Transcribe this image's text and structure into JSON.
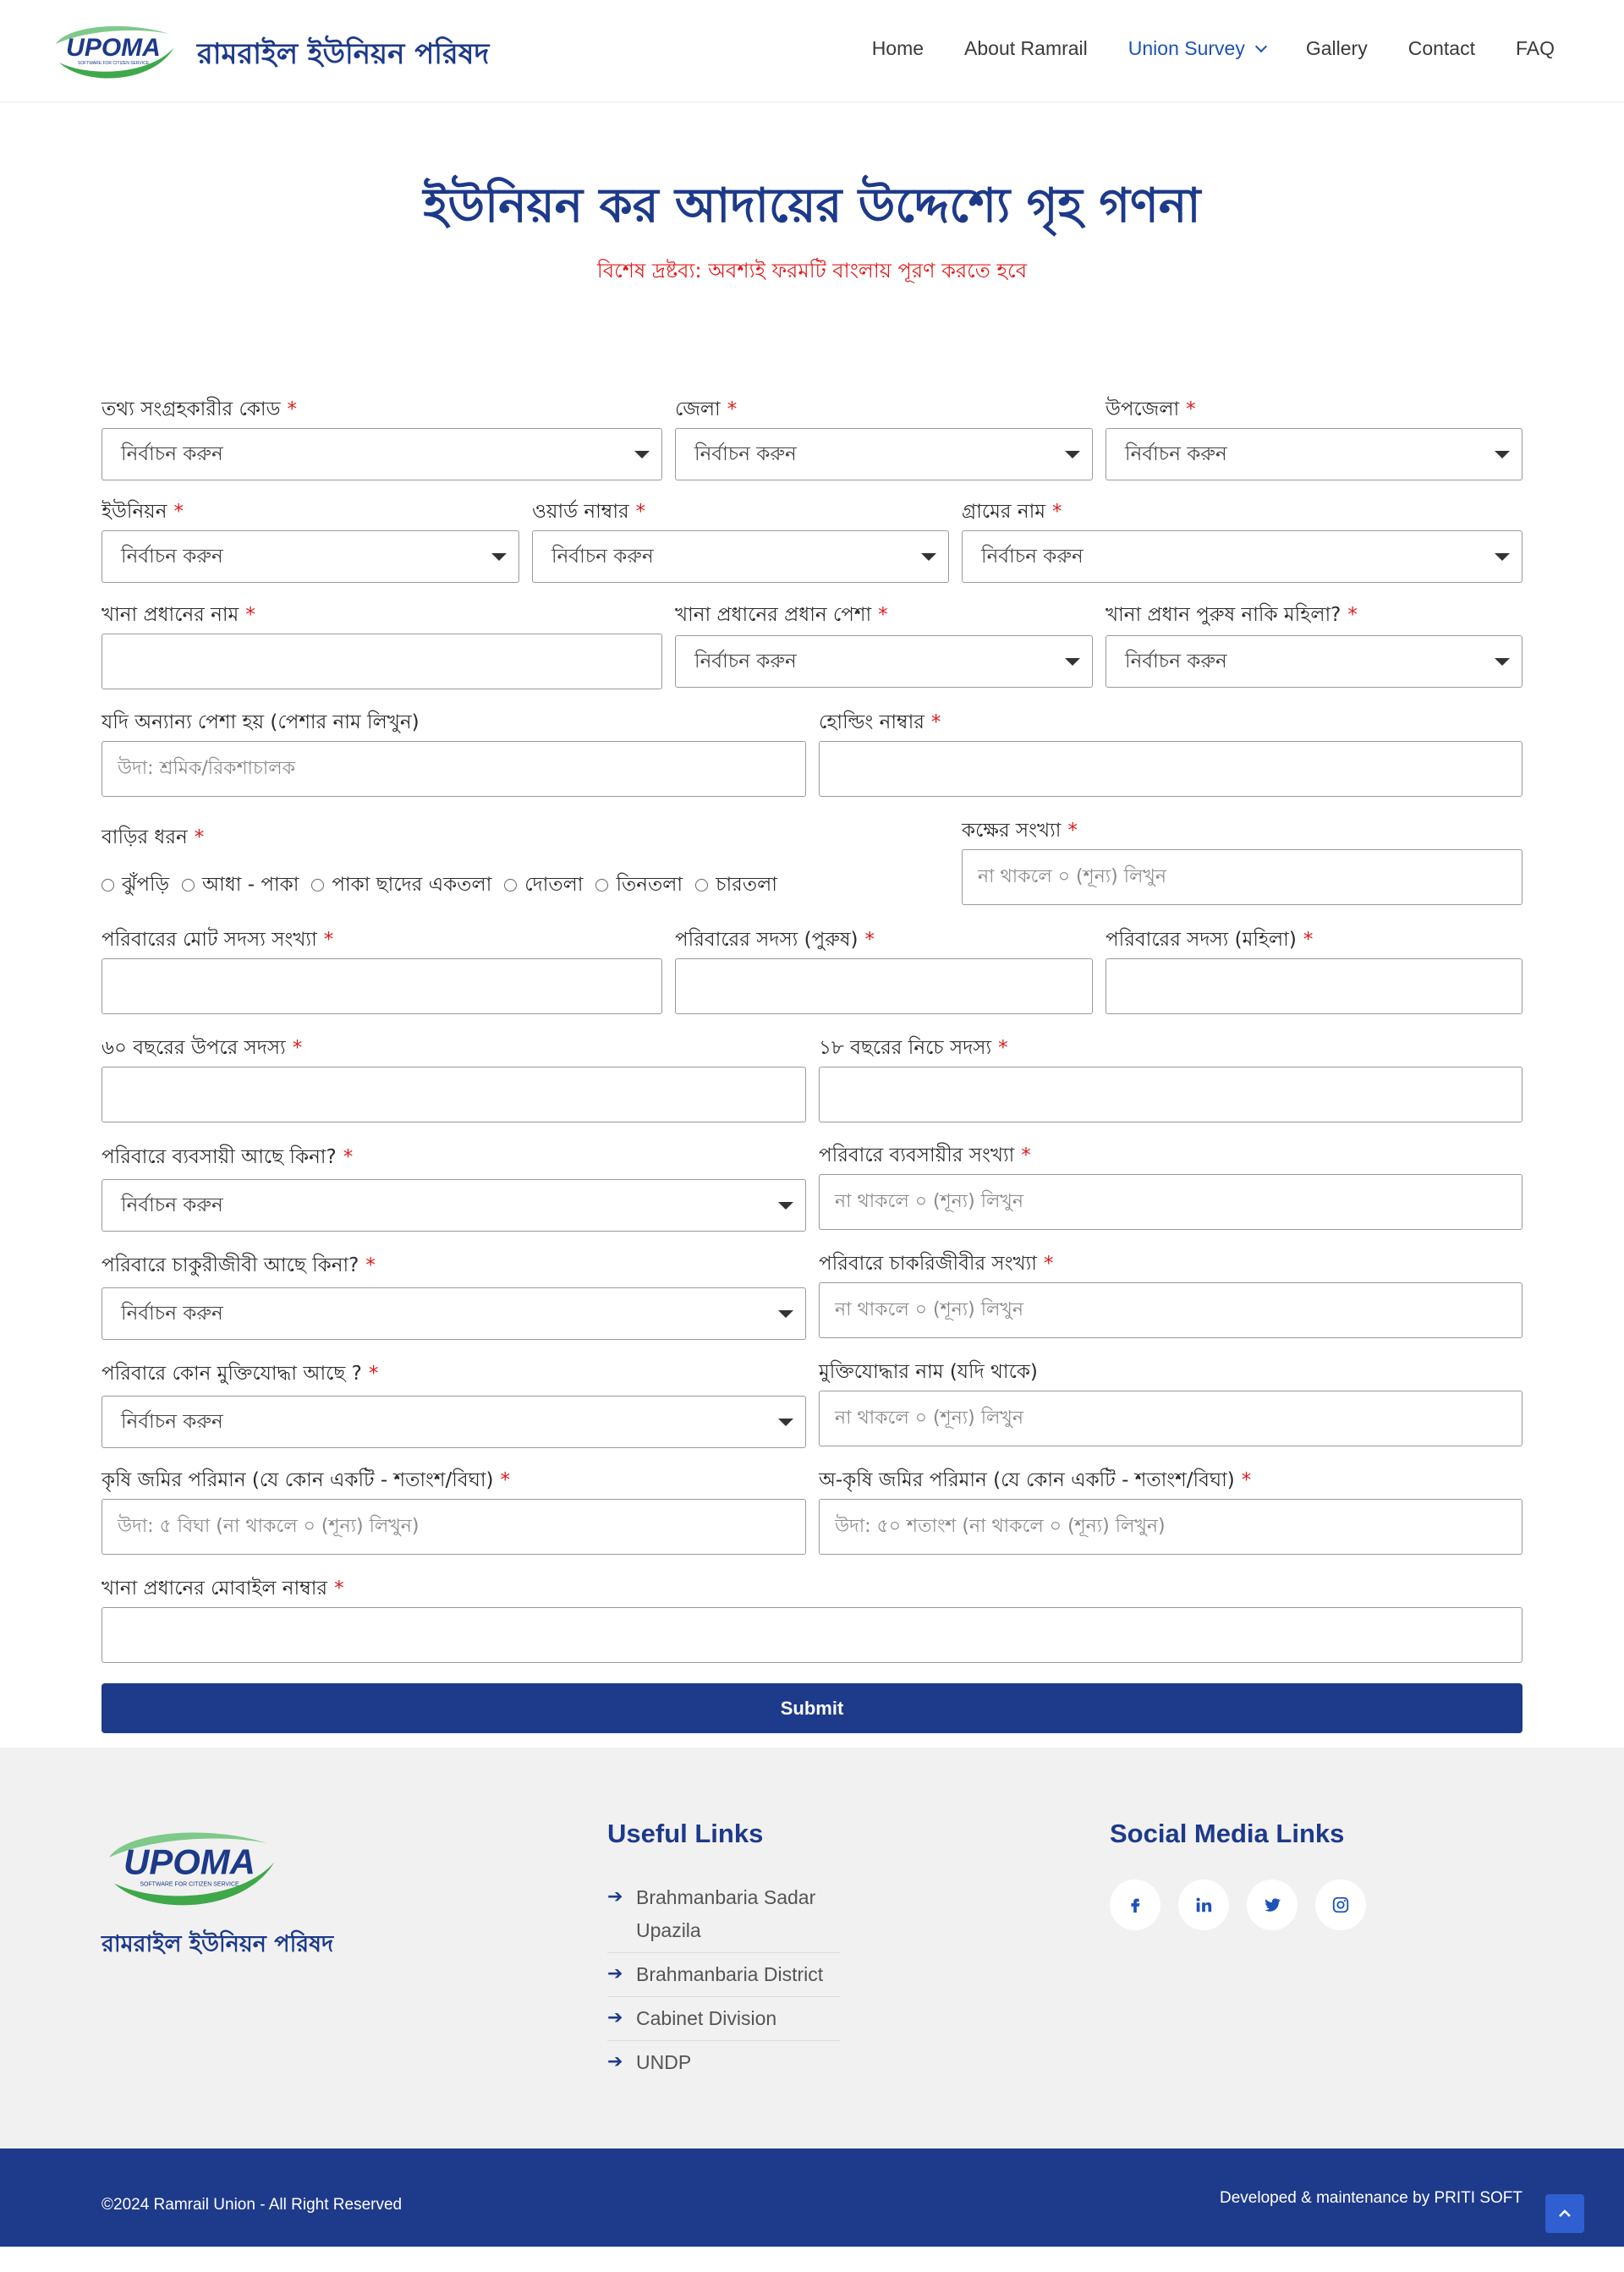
{
  "header": {
    "logo_text": "UPOMA",
    "logo_tagline": "SOFTWARE FOR CITIZEN SERVICE",
    "site_title": "রামরাইল ইউনিয়ন পরিষদ",
    "nav": [
      "Home",
      "About Ramrail",
      "Union Survey",
      "Gallery",
      "Contact",
      "FAQ"
    ],
    "active_nav": "Union Survey"
  },
  "page": {
    "title": "ইউনিয়ন কর আদায়ের উদ্দেশ্যে গৃহ গণনা",
    "notice": "বিশেষ দ্রষ্টব্য: অবশ্যই ফরমটি বাংলায় পূরণ করতে হবে"
  },
  "form": {
    "select_placeholder": "নির্বাচন করুন",
    "required_mark": "*",
    "collector_code": "তথ্য সংগ্রহকারীর কোড",
    "district": "জেলা",
    "upazila": "উপজেলা",
    "union": "ইউনিয়ন",
    "ward_no": "ওয়ার্ড নাম্বার",
    "village": "গ্রামের নাম",
    "head_name": "খানা প্রধানের নাম",
    "head_occupation": "খানা প্রধানের প্রধান পেশা",
    "head_gender": "খানা প্রধান পুরুষ নাকি মহিলা?",
    "other_occupation": "যদি অন্যান্য পেশা হয় (পেশার নাম লিখুন)",
    "other_occupation_ph": "উদা: শ্রমিক/রিকশাচালক",
    "holding_no": "হোল্ডিং নাম্বার",
    "house_type": "বাড়ির ধরন",
    "house_options": [
      "ঝুঁপড়ি",
      "আধা - পাকা",
      "পাকা ছাদের একতলা",
      "দোতলা",
      "তিনতলা",
      "চারতলা"
    ],
    "rooms": "কক্ষের সংখ্যা",
    "zero_ph": "না থাকলে ০ (শূন্য) লিখুন",
    "total_members": "পরিবারের মোট সদস্য সংখ্যা",
    "male_members": "পরিবারের সদস্য (পুরুষ)",
    "female_members": "পরিবারের সদস্য (মহিলা)",
    "above_60": "৬০ বছরের উপরে সদস্য",
    "below_18": "১৮ বছরের নিচে সদস্য",
    "has_business": "পরিবারে ব্যবসায়ী আছে কিনা?",
    "business_count": "পরিবারে ব্যবসায়ীর সংখ্যা",
    "has_job": "পরিবারে চাকুরীজীবী আছে কিনা?",
    "job_count": "পরিবারে চাকরিজীবীর সংখ্যা",
    "has_freedom_fighter": "পরিবারে কোন মুক্তিযোদ্ধা আছে ?",
    "freedom_fighter_name": "মুক্তিযোদ্ধার নাম (যদি থাকে)",
    "agri_land": "কৃষি জমির পরিমান (যে কোন একটি - শতাংশ/বিঘা)",
    "agri_land_ph": "উদা: ৫ বিঘা (না থাকলে ০ (শূন্য) লিখুন)",
    "nonagri_land": "অ-কৃষি জমির পরিমান (যে কোন একটি - শতাংশ/বিঘা)",
    "nonagri_land_ph": "উদা: ৫০ শতাংশ (না থাকলে ০ (শূন্য) লিখুন)",
    "mobile": "খানা প্রধানের মোবাইল নাম্বার",
    "submit": "Submit"
  },
  "footer": {
    "logo_text": "UPOMA",
    "logo_tagline": "SOFTWARE FOR CITIZEN SERVICE",
    "title": "রামরাইল ইউনিয়ন পরিষদ",
    "useful_links_heading": "Useful Links",
    "useful_links": [
      "Brahmanbaria Sadar Upazila",
      "Brahmanbaria District",
      "Cabinet Division",
      "UNDP"
    ],
    "social_heading": "Social Media Links",
    "socials": [
      "facebook-icon",
      "linkedin-icon",
      "twitter-icon",
      "instagram-icon"
    ],
    "copyright": "©2024 Ramrail Union - All Right Reserved",
    "developer": "Developed & maintenance by PRITI SOFT"
  },
  "colors": {
    "brand_blue": "#1d3a8a",
    "accent_red": "#e01b1b",
    "logo_green": "#3fa84a"
  }
}
